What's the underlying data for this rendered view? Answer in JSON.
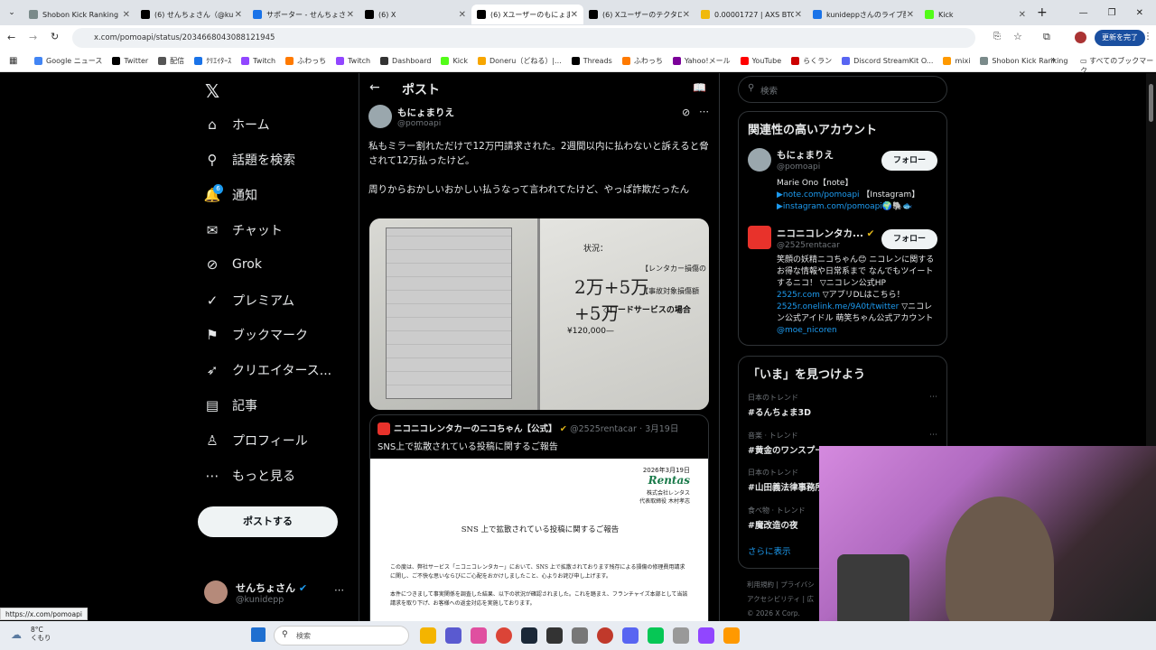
{
  "tabs": [
    {
      "label": "Shobon Kick Ranking",
      "color": "#7a8a8a"
    },
    {
      "label": "(6) せんちょさん（@kun",
      "color": "#000"
    },
    {
      "label": "サポーター - せんちょさん",
      "color": "#1a73e8"
    },
    {
      "label": "(6) X",
      "color": "#000"
    },
    {
      "label": "(6) Xユーザーのもにょまり",
      "color": "#000"
    },
    {
      "label": "(6) Xユーザーのテクタロ",
      "color": "#000"
    },
    {
      "label": "0.00001727 | AXS BTC",
      "color": "#f0b90b"
    },
    {
      "label": "kunideppさんのライブ配",
      "color": "#1a73e8"
    },
    {
      "label": "Kick",
      "color": "#53fc18"
    }
  ],
  "address": {
    "url": "x.com/pomoapi/status/2034668043088121945",
    "update_label": "更新を完了"
  },
  "bookmarks": [
    "Google ニュース",
    "Twitter",
    "配信",
    "ｸﾘｴｲﾀｰｽ",
    "Twitch",
    "ふわっち",
    "Twitch",
    "Dashboard",
    "Kick",
    "Doneru（どねる）|...",
    "Threads",
    "ふわっち",
    "Yahoo!メール",
    "YouTube",
    "らくラン",
    "Discord StreamKit O...",
    "mixi",
    "Shobon Kick Ranking"
  ],
  "bookmarks_all": "すべてのブックマーク",
  "nav": [
    {
      "label": "ホーム",
      "icon": "⌂"
    },
    {
      "label": "話題を検索",
      "icon": "⚲"
    },
    {
      "label": "通知",
      "icon": "🔔"
    },
    {
      "label": "チャット",
      "icon": "✉"
    },
    {
      "label": "Grok",
      "icon": "⊘"
    },
    {
      "label": "プレミアム",
      "icon": "✓"
    },
    {
      "label": "ブックマーク",
      "icon": "⚑"
    },
    {
      "label": "クリエイタース...",
      "icon": "➶"
    },
    {
      "label": "記事",
      "icon": "▤"
    },
    {
      "label": "プロフィール",
      "icon": "♙"
    },
    {
      "label": "もっと見る",
      "icon": "⋯"
    }
  ],
  "notif_badge": "6",
  "post_button": "ポストする",
  "account": {
    "name": "せんちょさん",
    "handle": "@kunidepp"
  },
  "header": {
    "title": "ポスト"
  },
  "post": {
    "name": "もにょまりえ",
    "handle": "@pomoapi",
    "text1": "私もミラー割れただけで12万円請求された。2週間以内に払わないと訴えると脅されて12万払ったけど。",
    "text2": "周りからおかしいおかしい払うなって言われてたけど、やっぱ詐欺だったん",
    "image_note": "¥120,000—",
    "image_label1": "状況：",
    "image_label2": "【レンタカー損傷の",
    "image_label3": "【事故対象損傷額",
    "image_label4": "◇ロードサービスの場合"
  },
  "quote": {
    "name": "ニコニコレンタカーのニコちゃん【公式】",
    "handle": "@2525rentacar",
    "date": "3月19日",
    "text": "SNS上で拡散されている投稿に関するご報告",
    "doc_date": "2026年3月19日",
    "doc_brand": "Rentas",
    "doc_company": "株式会社レンタス",
    "doc_rep": "代表取締役 木村孝志",
    "doc_title": "SNS 上で拡散されている投稿に関するご報告",
    "doc_body1": "この度は、弊社サービス「ニコニコレンタカー」において、SNS 上で拡散されております残存による損傷の修理費用請求に関し、ご不快な思いならびにご心配をおかけしましたこと、心よりお詫び申し上げます。",
    "doc_body2": "本件につきまして事実関係を調査した結果、以下の状況が確認されました。これを踏まえ、フランチャイズ本部として当該請求を取り下げ、お客様への返金対応を実施しております。"
  },
  "search": {
    "placeholder": "検索"
  },
  "related": {
    "title": "関連性の高いアカウント",
    "follow": "フォロー",
    "accounts": [
      {
        "name": "もにょまりえ",
        "handle": "@pomoapi",
        "bio1": "Marie Ono【note】",
        "bio2": "▶note.com/pomoapi",
        "bio2b": "【Instagram】",
        "bio3": "▶instagram.com/pomoapi🌍🐘🐟"
      },
      {
        "name": "ニコニコレンタカ...",
        "handle": "@2525rentacar",
        "bio1": "笑顔の妖精ニコちゃん😊 ニコレンに関する お得な情報や日常系まで なんでもツイートするニコ！ ▽ニコレン公式HP",
        "bio2": "2525r.com",
        "bio2b": "▽アプリDLはこちら！",
        "bio3": "2525r.onelink.me/9A0t/twitter",
        "bio4": "▽ニコレン公式アイドル 萌笑ちゃん公式アカウント",
        "bio5": "@moe_nicoren"
      }
    ]
  },
  "trends": {
    "title": "「いま」を見つけよう",
    "items": [
      {
        "cat": "日本のトレンド",
        "name": "#るんちょま3D"
      },
      {
        "cat": "音楽 · トレンド",
        "name": "#黄金のワンスプーン"
      },
      {
        "cat": "日本のトレンド",
        "name": "#山田義法律事務所"
      },
      {
        "cat": "食べ物 · トレンド",
        "name": "#魔改造の夜"
      }
    ],
    "more": "さらに表示"
  },
  "footer": {
    "l1": "利用規約 | プライバシ",
    "l2": "アクセシビリティ | 広",
    "l3": "© 2026 X Corp."
  },
  "status_url": "https://x.com/pomoapi",
  "weather": {
    "temp": "8°C",
    "cond": "くもり"
  },
  "taskbar_search": "検索"
}
